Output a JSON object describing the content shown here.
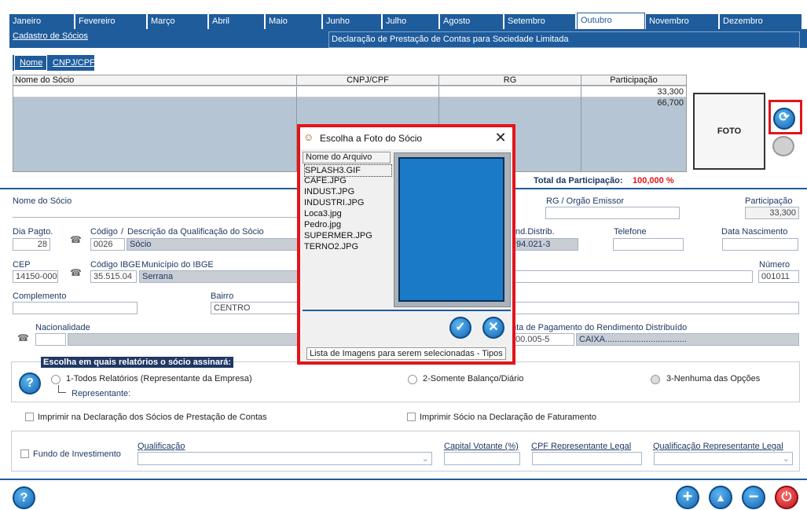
{
  "months": [
    "Janeiro",
    "Fevereiro",
    "Março",
    "Abril",
    "Maio",
    "Junho",
    "Julho",
    "Agosto",
    "Setembro",
    "Outubro",
    "Novembro",
    "Dezembro"
  ],
  "active_month": "Outubro",
  "panel_tabs": {
    "left": "Cadastro de Sócios",
    "right": "Declaração de Prestação de Contas para Sociedade Limitada"
  },
  "subtabs": [
    "Nome",
    "CNPJ/CPF"
  ],
  "grid": {
    "headers": [
      "Nome do Sócio",
      "CNPJ/CPF",
      "RG",
      "Participação"
    ],
    "rows": [
      {
        "participacao": "33,300"
      },
      {
        "participacao": "66,700"
      }
    ],
    "total_label": "Total da Participação:",
    "total_value": "100,000 %"
  },
  "foto_label": "FOTO",
  "form": {
    "nome_label": "Nome do Sócio",
    "rg_label": "RG / Orgão Emissor",
    "participacao_label": "Participação",
    "participacao_value": "33,300",
    "dia_label": "Dia Pagto.",
    "dia_value": "28",
    "codigo_label": "Código",
    "descricao_label": "Descrição da Qualificação do Sócio",
    "codigo_value": "0026",
    "descricao_value": "Sócio",
    "ind_label": "Ind.Distrib.",
    "ind_value": "94.021-3",
    "telefone_label": "Telefone",
    "nascimento_label": "Data Nascimento",
    "cep_label": "CEP",
    "cep_value": "14150-000",
    "ibge_label": "Código IBGE",
    "municipio_label": "Município do IBGE",
    "ibge_value": "35.515.04",
    "municipio_value": "Serrana",
    "numero_label": "Número",
    "numero_value": "001011",
    "complemento_label": "Complemento",
    "bairro_label": "Bairro",
    "bairro_value": "CENTRO",
    "nacionalidade_label": "Nacionalidade",
    "conta_label": "nta de Pagamento do Rendimento Distribuído",
    "conta_value": "00.005-5",
    "banco_value": "CAIXA.................................."
  },
  "relatorios": {
    "title": "Escolha  em  quais  relatórios  o sócio assinará:",
    "opt1": "1-Todos Relatórios (Representante da Empresa)",
    "opt2": "2-Somente Balanço/Diário",
    "opt3": "3-Nenhuma das Opções",
    "representante_label": "Representante:"
  },
  "checks": {
    "imprimir_decl": "Imprimir na Declaração dos Sócios de Prestação de Contas",
    "imprimir_fat": "Imprimir Sócio na Declaração de Faturamento",
    "fundo": "Fundo de Investimento"
  },
  "bottom": {
    "qualificacao_label": "Qualificação",
    "capital_label": "Capital Votante (%)",
    "cpf_rep_label": "CPF Representante Legal",
    "qual_rep_label": "Qualificação Representante Legal"
  },
  "dialog": {
    "title": "Escolha a Foto do Sócio",
    "list_header": "Nome do Arquivo",
    "files": [
      "SPLASH3.GIF",
      "CAFE.JPG",
      "INDUST.JPG",
      "INDUSTRI.JPG",
      "Loca3.jpg",
      "Pedro.jpg",
      "SUPERMER.JPG",
      "TERNO2.JPG"
    ],
    "status": "Lista de Imagens para serem selecionadas - Tipos de"
  },
  "colors": {
    "accent": "#1f5c9c",
    "highlight": "#e3141b",
    "total": "#e3141b",
    "preview": "#1a7ac8"
  }
}
